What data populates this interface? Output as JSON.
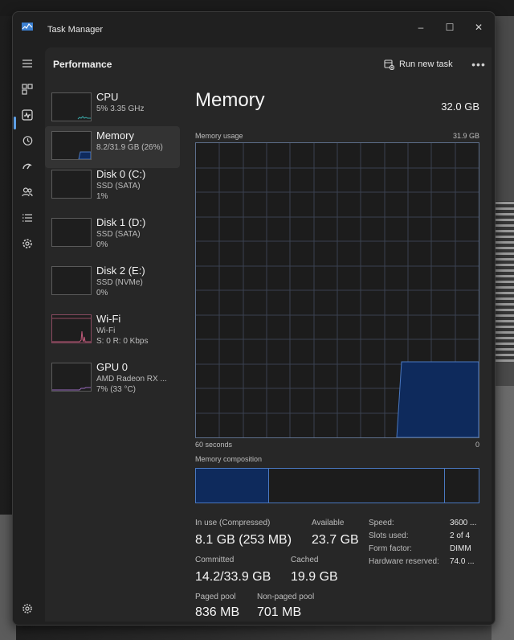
{
  "window": {
    "title": "Task Manager",
    "icon": "task-manager-icon"
  },
  "window_controls": {
    "minimize": "–",
    "maximize": "☐",
    "close": "✕"
  },
  "nav": {
    "items": [
      "hamburger-icon",
      "processes-icon",
      "performance-icon",
      "app-history-icon",
      "startup-apps-icon",
      "users-icon",
      "details-icon",
      "services-icon"
    ],
    "settings": "settings-icon",
    "selected": "performance-icon",
    "accent": "#5ea0e6"
  },
  "header": {
    "title": "Performance",
    "run_new_task": "Run new task",
    "more": "•••"
  },
  "devices": [
    {
      "name": "CPU",
      "line1": "5% 3.35 GHz",
      "line2": "",
      "color": "#3aa8a8"
    },
    {
      "name": "Memory",
      "line1": "8.2/31.9 GB (26%)",
      "line2": "",
      "color": "#4a78c0"
    },
    {
      "name": "Disk 0 (C:)",
      "line1": "SSD (SATA)",
      "line2": "1%",
      "color": "#5aa04a"
    },
    {
      "name": "Disk 1 (D:)",
      "line1": "SSD (SATA)",
      "line2": "0%",
      "color": "#5aa04a"
    },
    {
      "name": "Disk 2 (E:)",
      "line1": "SSD (NVMe)",
      "line2": "0%",
      "color": "#5aa04a"
    },
    {
      "name": "Wi-Fi",
      "line1": "Wi-Fi",
      "line2": "S: 0 R: 0 Kbps",
      "color": "#c05a7a"
    },
    {
      "name": "GPU 0",
      "line1": "AMD Radeon RX ...",
      "line2": "7% (33 °C)",
      "color": "#9a6ac0"
    }
  ],
  "detail": {
    "title": "Memory",
    "capacity": "32.0 GB",
    "usage_label": "Memory usage",
    "usage_max": "31.9 GB",
    "x_left": "60 seconds",
    "x_right": "0",
    "composition_label": "Memory composition",
    "graph_color": "#4a78c0",
    "fill_color": "#0e2a5c"
  },
  "stats": {
    "in_use_label": "In use (Compressed)",
    "in_use_value": "8.1 GB (253 MB)",
    "available_label": "Available",
    "available_value": "23.7 GB",
    "committed_label": "Committed",
    "committed_value": "14.2/33.9 GB",
    "cached_label": "Cached",
    "cached_value": "19.9 GB",
    "paged_label": "Paged pool",
    "paged_value": "836 MB",
    "nonpaged_label": "Non-paged pool",
    "nonpaged_value": "701 MB"
  },
  "specs": [
    {
      "key": "Speed:",
      "value": "3600 ..."
    },
    {
      "key": "Slots used:",
      "value": "2 of 4"
    },
    {
      "key": "Form factor:",
      "value": "DIMM"
    },
    {
      "key": "Hardware reserved:",
      "value": "74.0 ..."
    }
  ]
}
